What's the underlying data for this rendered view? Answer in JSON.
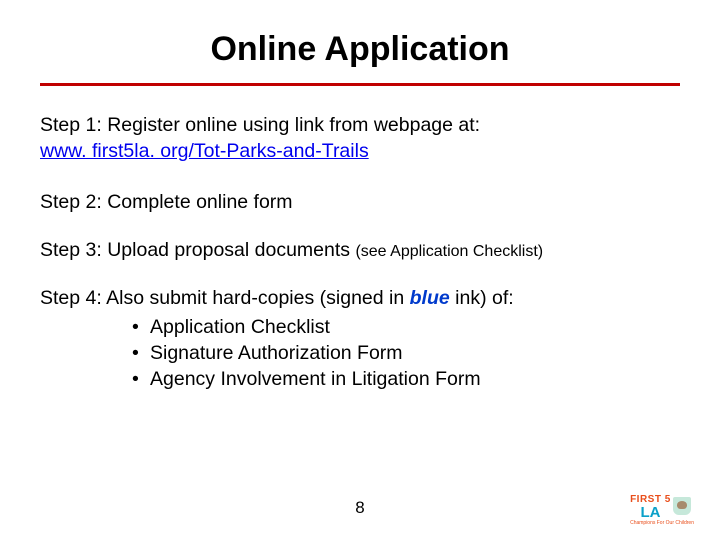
{
  "title": "Online Application",
  "step1": {
    "label": "Step 1:  Register online using link from webpage at:",
    "link": "www. first5la. org/Tot-Parks-and-Trails"
  },
  "step2": "Step 2:  Complete online form",
  "step3": {
    "label": "Step 3:  Upload proposal documents ",
    "note": "(see Application Checklist)"
  },
  "step4": {
    "prefix": "Step 4: Also submit hard-copies (signed in ",
    "blue": "blue",
    "suffix": " ink) of:",
    "items": [
      "Application Checklist",
      "Signature Authorization Form",
      "Agency Involvement in Litigation Form"
    ]
  },
  "pageNumber": "8",
  "logo": {
    "top": "FIRST 5",
    "bot": "LA",
    "tagline": "Champions For Our Children"
  }
}
